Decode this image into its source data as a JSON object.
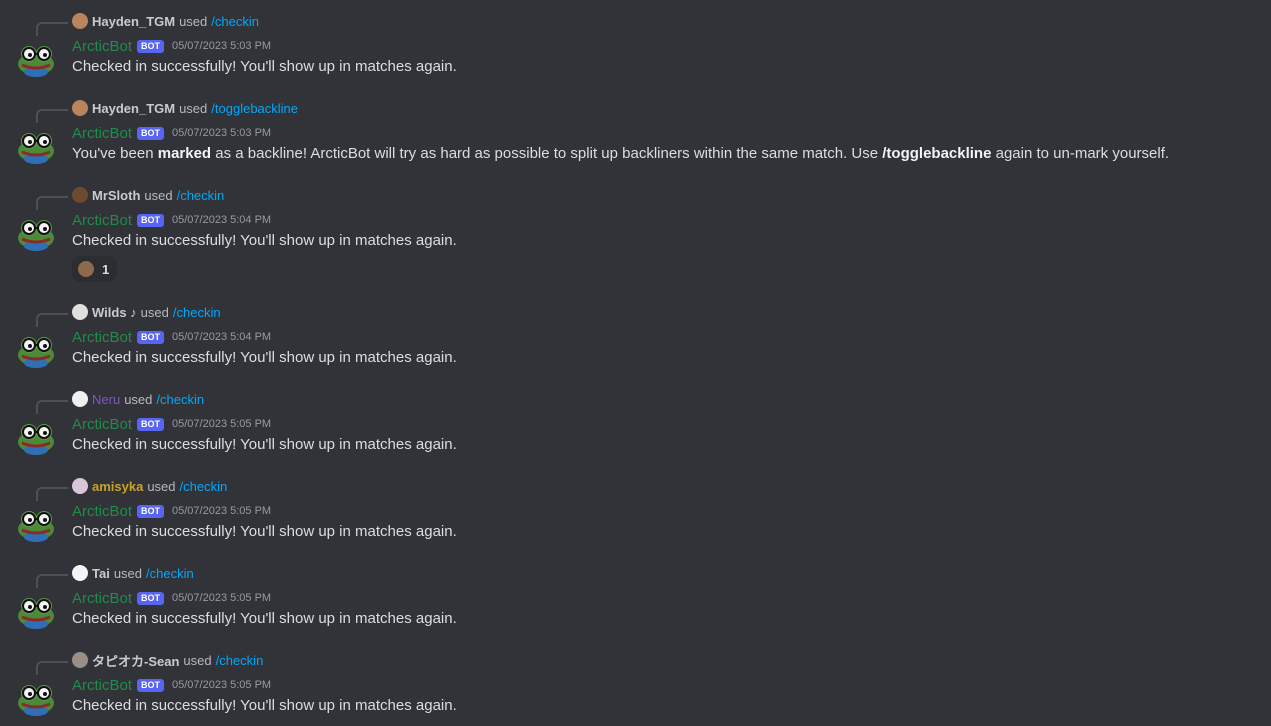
{
  "colors": {
    "background": "#313338",
    "bot_name": "#1f8b4c",
    "bot_tag": "#5865f2",
    "command": "#00a8fc",
    "neru_name": "#7e57c2",
    "amisyka_name": "#c9a227"
  },
  "bot": {
    "name": "ArcticBot",
    "tag": "BOT",
    "avatar_icon": "pepe-frog-glasses-icon"
  },
  "used_word": "used",
  "messages": [
    {
      "user": "Hayden_TGM",
      "command": "/checkin",
      "timestamp": "05/07/2023 5:03 PM",
      "text": "Checked in successfully! You'll show up in matches again."
    },
    {
      "user": "Hayden_TGM",
      "command": "/togglebackline",
      "timestamp": "05/07/2023 5:03 PM",
      "text_parts": [
        "You've been ",
        "marked",
        " as a backline! ArcticBot will try as hard as possible to split up backliners within the same match. Use ",
        "/togglebackline",
        " again to un-mark yourself."
      ]
    },
    {
      "user": "MrSloth",
      "command": "/checkin",
      "timestamp": "05/07/2023 5:04 PM",
      "text": "Checked in successfully! You'll show up in matches again.",
      "reaction": {
        "emoji_icon": "sloth-icon",
        "count": "1"
      }
    },
    {
      "user": "Wilds ♪",
      "command": "/checkin",
      "timestamp": "05/07/2023 5:04 PM",
      "text": "Checked in successfully! You'll show up in matches again."
    },
    {
      "user": "Neru",
      "command": "/checkin",
      "timestamp": "05/07/2023 5:05 PM",
      "text": "Checked in successfully! You'll show up in matches again."
    },
    {
      "user": "amisyka",
      "command": "/checkin",
      "timestamp": "05/07/2023 5:05 PM",
      "text": "Checked in successfully! You'll show up in matches again."
    },
    {
      "user": "Tai",
      "command": "/checkin",
      "timestamp": "05/07/2023 5:05 PM",
      "text": "Checked in successfully! You'll show up in matches again."
    },
    {
      "user": "タピオカ-Sean",
      "command": "/checkin",
      "timestamp": "05/07/2023 5:05 PM",
      "text": "Checked in successfully! You'll show up in matches again."
    }
  ]
}
